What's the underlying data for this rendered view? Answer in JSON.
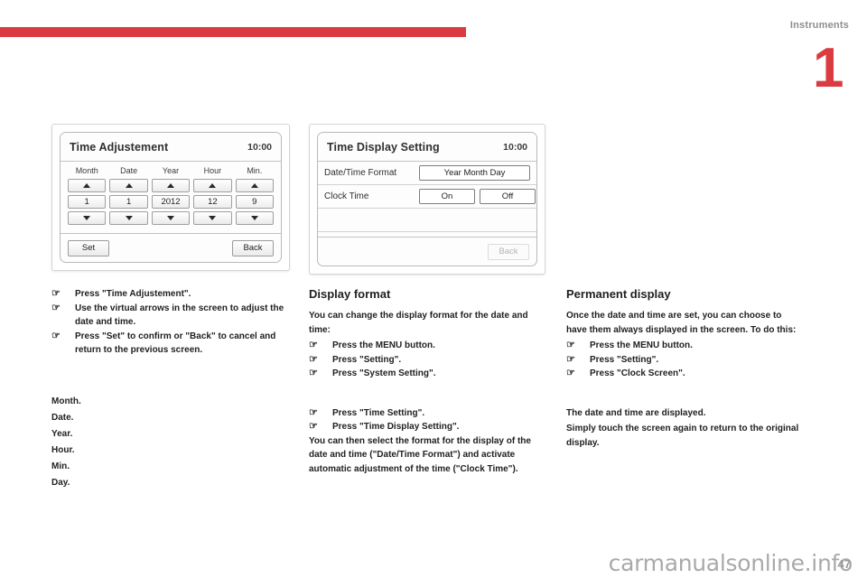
{
  "header": {
    "section_title": "Instruments",
    "chapter_number": "1",
    "rule_color": "#d93b40"
  },
  "figures": {
    "time_adjustment": {
      "title": "Time Adjustement",
      "clock": "10:00",
      "columns": [
        {
          "label": "Month",
          "up_icon": "triangle-up-icon",
          "value": "1",
          "down_icon": "triangle-down-icon"
        },
        {
          "label": "Date",
          "up_icon": "triangle-up-icon",
          "value": "1",
          "down_icon": "triangle-down-icon"
        },
        {
          "label": "Year",
          "up_icon": "triangle-up-icon",
          "value": "2012",
          "down_icon": "triangle-down-icon"
        },
        {
          "label": "Hour",
          "up_icon": "triangle-up-icon",
          "value": "12",
          "down_icon": "triangle-down-icon"
        },
        {
          "label": "Min.",
          "up_icon": "triangle-up-icon",
          "value": "9",
          "down_icon": "triangle-down-icon"
        }
      ],
      "set_label": "Set",
      "back_label": "Back"
    },
    "time_display_setting": {
      "title": "Time Display Setting",
      "clock": "10:00",
      "rows": [
        {
          "label": "Date/Time Format",
          "options": [
            "Year Month Day"
          ]
        },
        {
          "label": "Clock Time",
          "options": [
            "On",
            "Off"
          ]
        }
      ],
      "back_label": "Back"
    }
  },
  "columns": {
    "left": {
      "bullets": [
        "Press \"Time Adjustement\".",
        "Use the virtual arrows in the screen to adjust the date and time.",
        "Press \"Set\" to confirm or \"Back\" to cancel and return to the previous screen."
      ],
      "fields": [
        "Month.",
        "Date.",
        "Year.",
        "Hour.",
        "Min.",
        "Day."
      ]
    },
    "middle": {
      "heading": "Display format",
      "intro": "You can change the display format for the date and time:",
      "bullets_first": [
        "Press the MENU button.",
        "Press \"Setting\".",
        "Press \"System Setting\"."
      ],
      "bullets_second": [
        "Press \"Time Setting\".",
        "Press \"Time Display Setting\"."
      ],
      "outro": "You can then select the format for the display of the date and time (\"Date/Time Format\") and activate automatic adjustment of the time (\"Clock Time\")."
    },
    "right": {
      "heading": "Permanent display",
      "intro": "Once the date and time are set, you can choose to have them always displayed in the screen. To do this:",
      "bullets": [
        "Press the MENU button.",
        "Press \"Setting\".",
        "Press \"Clock Screen\"."
      ],
      "outro_line1": "The date and time are displayed.",
      "outro_line2": "Simply touch the screen again to return to the original display."
    }
  },
  "footer": {
    "page_number": "47",
    "watermark": "carmanualsonline.info"
  },
  "icons": {
    "bullet": "☞"
  }
}
